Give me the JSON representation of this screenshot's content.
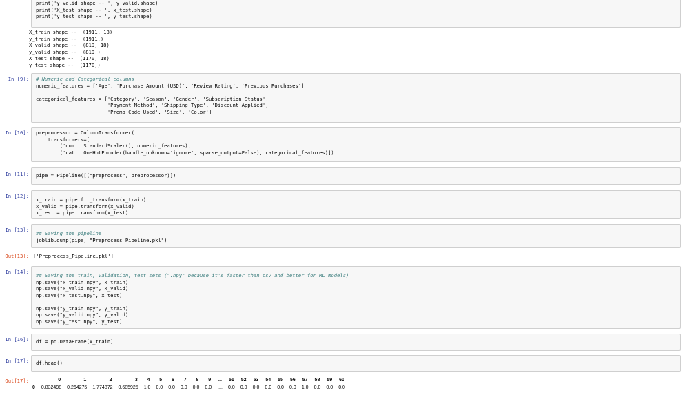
{
  "cells": {
    "top": {
      "lines": [
        "print('y_valid shape -- ', y_valid.shape)",
        "print('X_test shape -- ', x_test.shape)",
        "print('y_test shape -- ', y_test.shape)"
      ],
      "output": "X_train shape --  (1911, 18)\ny_train shape --  (1911,)\nX_valid shape --  (819, 18)\ny_valid shape --  (819,)\nX_test shape --  (1170, 18)\ny_test shape --  (1170,)"
    },
    "c9": {
      "prompt": "In [9]:",
      "comment": "# Numeric and Categorical columns",
      "numeric_line": "numeric_features = ['Age', 'Purchase Amount (USD)', 'Review Rating', 'Previous Purchases']",
      "cat_line1": "categorical_features = ['Category', 'Season', 'Gender', 'Subscription Status',",
      "cat_line2": "                        'Payment Method', 'Shipping Type', 'Discount Applied',",
      "cat_line3": "                        'Promo Code Used', 'Size', 'Color']"
    },
    "c10": {
      "prompt": "In [10]:",
      "line1": "preprocessor = ColumnTransformer(",
      "line2": "    transformers=[",
      "line3": "        ('num', StandardScaler(), numeric_features),",
      "line4": "        ('cat', OneHotEncoder(handle_unknown='ignore', sparse_output=False), categorical_features)])"
    },
    "c11": {
      "prompt": "In [11]:",
      "line1": "pipe = Pipeline([(\"preprocess\", preprocessor)])"
    },
    "c12": {
      "prompt": "In [12]:",
      "line1": "x_train = pipe.fit_transform(x_train)",
      "line2": "x_valid = pipe.transform(x_valid)",
      "line3": "x_test = pipe.transform(x_test)"
    },
    "c13": {
      "prompt": "In [13]:",
      "comment": "## Saving the pipeline",
      "line1": "joblib.dump(pipe, \"Preprocess_Pipeline.pkl\")",
      "out_prompt": "Out[13]:",
      "output": "['Preprocess_Pipeline.pkl']"
    },
    "c14": {
      "prompt": "In [14]:",
      "comment": "## Saving the train, validation, test sets (\".npy\" because it's faster than csv and better for ML models)",
      "line1": "np.save(\"x_train.npy\", x_train)",
      "line2": "np.save(\"x_valid.npy\", x_valid)",
      "line3": "np.save(\"x_test.npy\", x_test)",
      "line4": "np.save(\"y_train.npy\", y_train)",
      "line5": "np.save(\"y_valid.npy\", y_valid)",
      "line6": "np.save(\"y_test.npy\", y_test)"
    },
    "c16": {
      "prompt": "In [16]:",
      "line1": "df = pd.DataFrame(x_train)"
    },
    "c17": {
      "prompt": "In [17]:",
      "line1": "df.head()",
      "out_prompt": "Out[17]:"
    }
  },
  "dataframe": {
    "columns": [
      "",
      "0",
      "1",
      "2",
      "3",
      "4",
      "5",
      "6",
      "7",
      "8",
      "9",
      "...",
      "51",
      "52",
      "53",
      "54",
      "55",
      "56",
      "57",
      "58",
      "59",
      "60"
    ],
    "rows": [
      [
        "0",
        "0.832498",
        "0.264275",
        "1.774872",
        "0.685925",
        "1.0",
        "0.0",
        "0.0",
        "0.0",
        "0.0",
        "0.0",
        "...",
        "0.0",
        "0.0",
        "0.0",
        "0.0",
        "0.0",
        "0.0",
        "1.0",
        "0.0",
        "0.0",
        "0.0"
      ]
    ]
  }
}
